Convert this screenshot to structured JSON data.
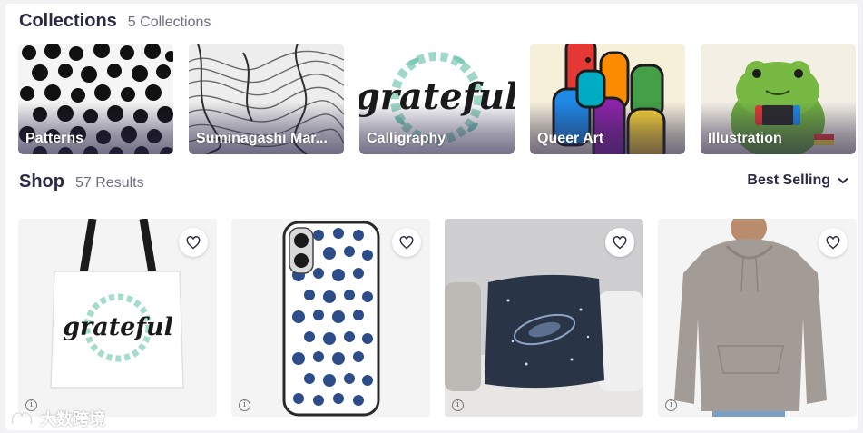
{
  "collections": {
    "title": "Collections",
    "count": "5 Collections",
    "items": [
      {
        "label": "Patterns"
      },
      {
        "label": "Suminagashi Mar..."
      },
      {
        "label": "Calligraphy"
      },
      {
        "label": "Queer Art"
      },
      {
        "label": "Illustration"
      }
    ]
  },
  "shop": {
    "title": "Shop",
    "results": "57 Results",
    "sort_label": "Best Selling",
    "products": [
      {
        "kind": "tote bag",
        "favorite_icon": "heart-outline-icon"
      },
      {
        "kind": "phone case",
        "favorite_icon": "heart-outline-icon"
      },
      {
        "kind": "throw pillow",
        "favorite_icon": "heart-outline-icon"
      },
      {
        "kind": "hoodie",
        "favorite_icon": "heart-outline-icon"
      }
    ],
    "info_glyph": "i"
  },
  "artwork_text": {
    "calligraphy_word": "grateful"
  },
  "watermark": {
    "text": "大数跨境"
  },
  "colors": {
    "text_primary": "#2b2a45",
    "text_muted": "#6e6e85",
    "card_bg": "#f4f4f5"
  }
}
